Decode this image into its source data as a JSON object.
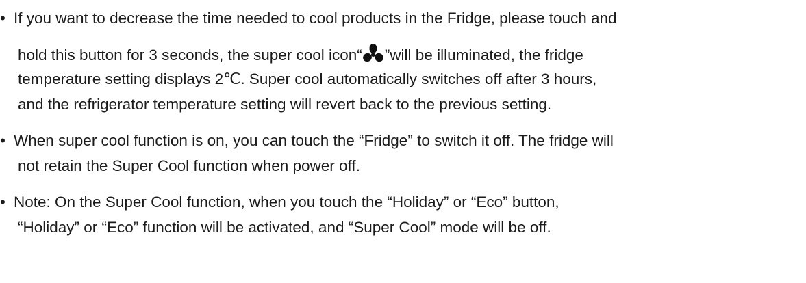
{
  "document": {
    "bullet": "•",
    "items": [
      {
        "lines": [
          "If you want to decrease the time needed to cool products in the Fridge, please touch and",
          "hold this button for 3 seconds, the super cool icon“",
          "”will be illuminated, the fridge",
          "temperature setting displays 2℃. Super cool automatically switches off after 3 hours,",
          "and the refrigerator temperature setting will revert back to the previous setting."
        ],
        "icon": "super-cool-fan-icon"
      },
      {
        "lines": [
          "When super cool function is on, you can touch the “Fridge” to switch it off. The fridge will",
          "not retain the Super Cool function when power off."
        ]
      },
      {
        "lines": [
          "Note: On the Super Cool function, when you touch the “Holiday” or “Eco” button,",
          "“Holiday” or “Eco” function will be activated, and “Super Cool” mode will be off."
        ]
      }
    ]
  },
  "colors": {
    "text": "#1b1b1b",
    "icon": "#111111",
    "background": "#ffffff"
  }
}
